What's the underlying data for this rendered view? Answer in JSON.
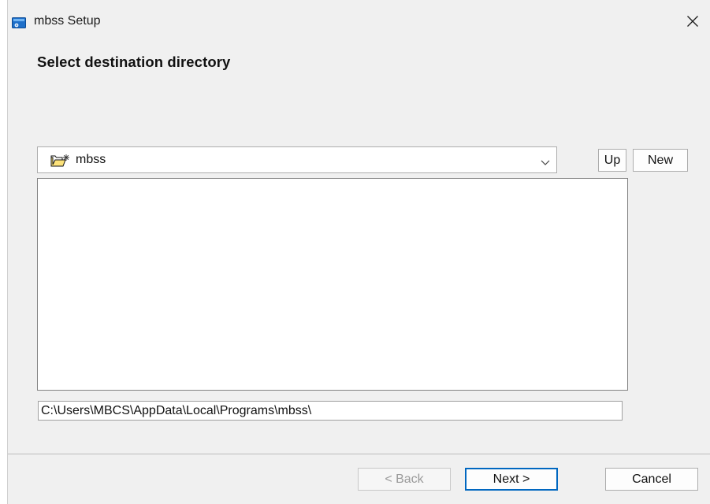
{
  "window": {
    "title": "mbss Setup",
    "close_symbol": "✕",
    "icons": {
      "app": "installer-app-icon",
      "close": "close-icon"
    }
  },
  "page": {
    "heading": "Select destination directory"
  },
  "directory_selector": {
    "current_folder": "mbss",
    "folder_icon": "new-folder-icon",
    "dropdown_icon": "chevron-down-icon",
    "up_label": "Up",
    "new_label": "New"
  },
  "directory_list": {
    "items": []
  },
  "path_field": {
    "value": "C:\\Users\\MBCS\\AppData\\Local\\Programs\\mbss\\"
  },
  "footer": {
    "back_label": "< Back",
    "next_label": "Next >",
    "cancel_label": "Cancel"
  },
  "colors": {
    "window_bg": "#f0f0f0",
    "default_button_border": "#0067c0",
    "disabled_text": "#9a9a9a"
  }
}
